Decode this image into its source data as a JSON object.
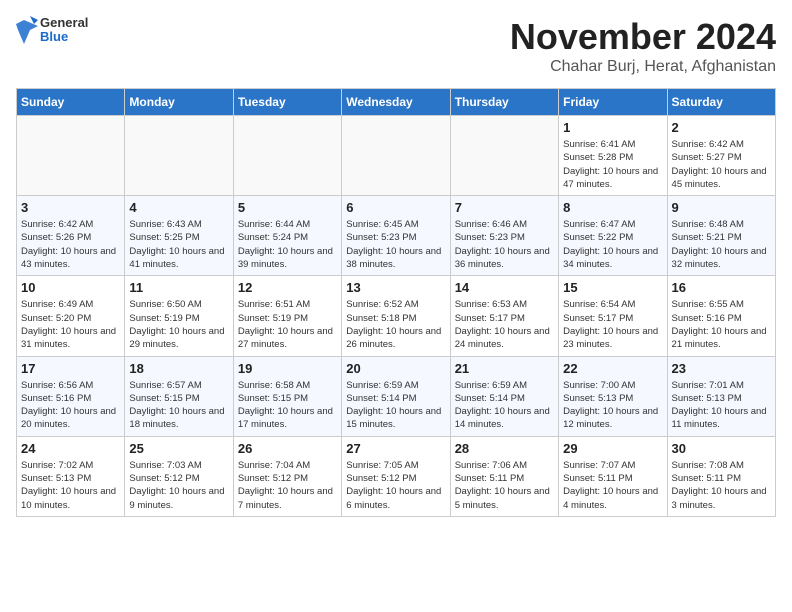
{
  "header": {
    "logo_general": "General",
    "logo_blue": "Blue",
    "month": "November 2024",
    "location": "Chahar Burj, Herat, Afghanistan"
  },
  "weekdays": [
    "Sunday",
    "Monday",
    "Tuesday",
    "Wednesday",
    "Thursday",
    "Friday",
    "Saturday"
  ],
  "weeks": [
    [
      {
        "day": "",
        "info": ""
      },
      {
        "day": "",
        "info": ""
      },
      {
        "day": "",
        "info": ""
      },
      {
        "day": "",
        "info": ""
      },
      {
        "day": "",
        "info": ""
      },
      {
        "day": "1",
        "info": "Sunrise: 6:41 AM\nSunset: 5:28 PM\nDaylight: 10 hours\nand 47 minutes."
      },
      {
        "day": "2",
        "info": "Sunrise: 6:42 AM\nSunset: 5:27 PM\nDaylight: 10 hours\nand 45 minutes."
      }
    ],
    [
      {
        "day": "3",
        "info": "Sunrise: 6:42 AM\nSunset: 5:26 PM\nDaylight: 10 hours\nand 43 minutes."
      },
      {
        "day": "4",
        "info": "Sunrise: 6:43 AM\nSunset: 5:25 PM\nDaylight: 10 hours\nand 41 minutes."
      },
      {
        "day": "5",
        "info": "Sunrise: 6:44 AM\nSunset: 5:24 PM\nDaylight: 10 hours\nand 39 minutes."
      },
      {
        "day": "6",
        "info": "Sunrise: 6:45 AM\nSunset: 5:23 PM\nDaylight: 10 hours\nand 38 minutes."
      },
      {
        "day": "7",
        "info": "Sunrise: 6:46 AM\nSunset: 5:23 PM\nDaylight: 10 hours\nand 36 minutes."
      },
      {
        "day": "8",
        "info": "Sunrise: 6:47 AM\nSunset: 5:22 PM\nDaylight: 10 hours\nand 34 minutes."
      },
      {
        "day": "9",
        "info": "Sunrise: 6:48 AM\nSunset: 5:21 PM\nDaylight: 10 hours\nand 32 minutes."
      }
    ],
    [
      {
        "day": "10",
        "info": "Sunrise: 6:49 AM\nSunset: 5:20 PM\nDaylight: 10 hours\nand 31 minutes."
      },
      {
        "day": "11",
        "info": "Sunrise: 6:50 AM\nSunset: 5:19 PM\nDaylight: 10 hours\nand 29 minutes."
      },
      {
        "day": "12",
        "info": "Sunrise: 6:51 AM\nSunset: 5:19 PM\nDaylight: 10 hours\nand 27 minutes."
      },
      {
        "day": "13",
        "info": "Sunrise: 6:52 AM\nSunset: 5:18 PM\nDaylight: 10 hours\nand 26 minutes."
      },
      {
        "day": "14",
        "info": "Sunrise: 6:53 AM\nSunset: 5:17 PM\nDaylight: 10 hours\nand 24 minutes."
      },
      {
        "day": "15",
        "info": "Sunrise: 6:54 AM\nSunset: 5:17 PM\nDaylight: 10 hours\nand 23 minutes."
      },
      {
        "day": "16",
        "info": "Sunrise: 6:55 AM\nSunset: 5:16 PM\nDaylight: 10 hours\nand 21 minutes."
      }
    ],
    [
      {
        "day": "17",
        "info": "Sunrise: 6:56 AM\nSunset: 5:16 PM\nDaylight: 10 hours\nand 20 minutes."
      },
      {
        "day": "18",
        "info": "Sunrise: 6:57 AM\nSunset: 5:15 PM\nDaylight: 10 hours\nand 18 minutes."
      },
      {
        "day": "19",
        "info": "Sunrise: 6:58 AM\nSunset: 5:15 PM\nDaylight: 10 hours\nand 17 minutes."
      },
      {
        "day": "20",
        "info": "Sunrise: 6:59 AM\nSunset: 5:14 PM\nDaylight: 10 hours\nand 15 minutes."
      },
      {
        "day": "21",
        "info": "Sunrise: 6:59 AM\nSunset: 5:14 PM\nDaylight: 10 hours\nand 14 minutes."
      },
      {
        "day": "22",
        "info": "Sunrise: 7:00 AM\nSunset: 5:13 PM\nDaylight: 10 hours\nand 12 minutes."
      },
      {
        "day": "23",
        "info": "Sunrise: 7:01 AM\nSunset: 5:13 PM\nDaylight: 10 hours\nand 11 minutes."
      }
    ],
    [
      {
        "day": "24",
        "info": "Sunrise: 7:02 AM\nSunset: 5:13 PM\nDaylight: 10 hours\nand 10 minutes."
      },
      {
        "day": "25",
        "info": "Sunrise: 7:03 AM\nSunset: 5:12 PM\nDaylight: 10 hours\nand 9 minutes."
      },
      {
        "day": "26",
        "info": "Sunrise: 7:04 AM\nSunset: 5:12 PM\nDaylight: 10 hours\nand 7 minutes."
      },
      {
        "day": "27",
        "info": "Sunrise: 7:05 AM\nSunset: 5:12 PM\nDaylight: 10 hours\nand 6 minutes."
      },
      {
        "day": "28",
        "info": "Sunrise: 7:06 AM\nSunset: 5:11 PM\nDaylight: 10 hours\nand 5 minutes."
      },
      {
        "day": "29",
        "info": "Sunrise: 7:07 AM\nSunset: 5:11 PM\nDaylight: 10 hours\nand 4 minutes."
      },
      {
        "day": "30",
        "info": "Sunrise: 7:08 AM\nSunset: 5:11 PM\nDaylight: 10 hours\nand 3 minutes."
      }
    ]
  ]
}
